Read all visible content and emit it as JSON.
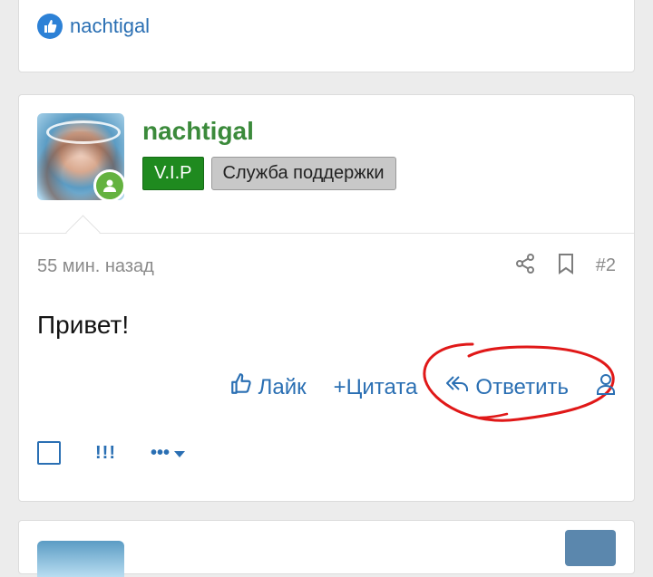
{
  "top_card": {
    "reaction_user": "nachtigal"
  },
  "post": {
    "username": "nachtigal",
    "badges": [
      "V.I.P",
      "Служба поддержки"
    ],
    "timestamp": "55 мин. назад",
    "post_number": "#2",
    "message": "Привет!",
    "actions": {
      "like": "Лайк",
      "quote": "+Цитата",
      "reply": "Ответить"
    },
    "tools": {
      "mark": "!!!"
    }
  },
  "colors": {
    "link": "#2a6fb3",
    "username": "#3b8a3b",
    "vip_badge": "#1f8a1f",
    "annotation": "#e01818"
  }
}
